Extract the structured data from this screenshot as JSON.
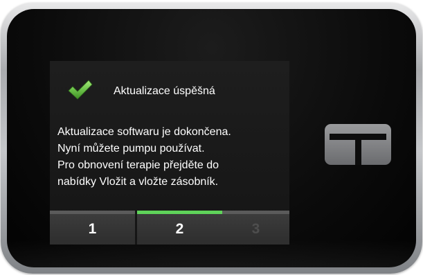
{
  "dialog": {
    "title": "Aktualizace úspěšná",
    "icon": "checkmark-icon",
    "message_lines": [
      "Aktualizace softwaru je dokončena.",
      "Nyní můžete pumpu používat.",
      "Pro obnovení terapie přejděte do",
      "nabídky Vložit a vložte zásobník."
    ]
  },
  "steps": [
    {
      "label": "1",
      "state": "completed"
    },
    {
      "label": "2",
      "state": "active"
    },
    {
      "label": "3",
      "state": "disabled"
    }
  ],
  "device": {
    "logo_icon": "t-logo-icon"
  },
  "colors": {
    "accent": "#5fd35a",
    "check_green": "#6cc24a",
    "screen_bg": "#1a1a1a"
  }
}
